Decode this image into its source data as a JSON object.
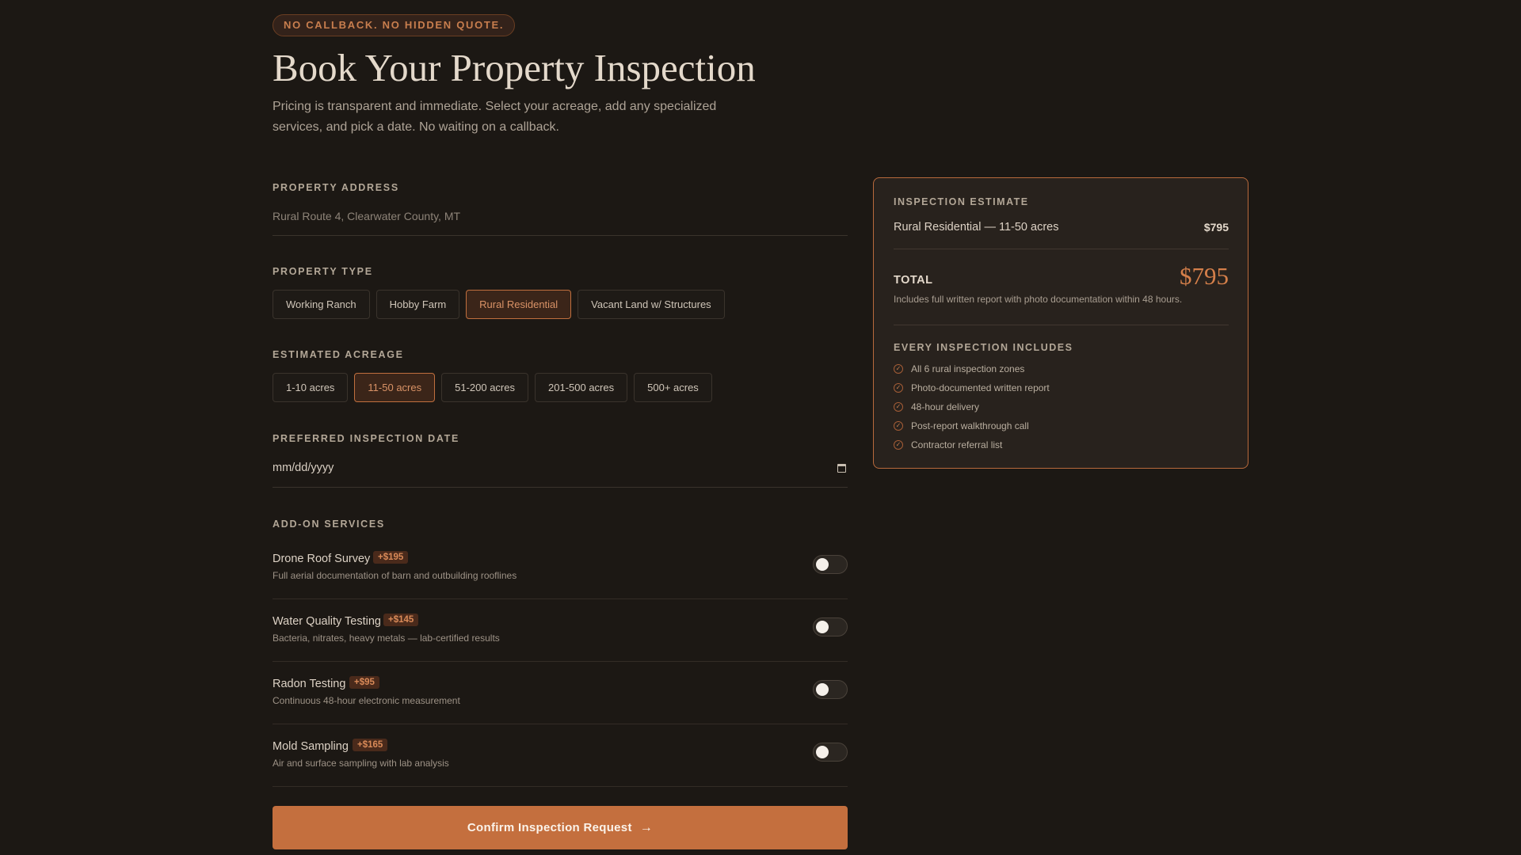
{
  "header": {
    "badge": "NO CALLBACK. NO HIDDEN QUOTE.",
    "title": "Book Your Property Inspection",
    "subtitle": "Pricing is transparent and immediate. Select your acreage, add any specialized services, and pick a date. No waiting on a callback."
  },
  "address": {
    "label": "PROPERTY ADDRESS",
    "placeholder": "Rural Route 4, Clearwater County, MT"
  },
  "property_type": {
    "label": "PROPERTY TYPE",
    "options": [
      "Working Ranch",
      "Hobby Farm",
      "Rural Residential",
      "Vacant Land w/ Structures"
    ],
    "selected": "Rural Residential"
  },
  "acreage": {
    "label": "ESTIMATED ACREAGE",
    "options": [
      "1-10 acres",
      "11-50 acres",
      "51-200 acres",
      "201-500 acres",
      "500+ acres"
    ],
    "selected": "11-50 acres"
  },
  "date": {
    "label": "PREFERRED INSPECTION DATE",
    "placeholder": "mm/dd/yyyy"
  },
  "addons": {
    "label": "ADD-ON SERVICES",
    "items": [
      {
        "name": "Drone Roof Survey",
        "price": "+$195",
        "desc": "Full aerial documentation of barn and outbuilding rooflines",
        "enabled": false
      },
      {
        "name": "Water Quality Testing",
        "price": "+$145",
        "desc": "Bacteria, nitrates, heavy metals — lab-certified results",
        "enabled": false
      },
      {
        "name": "Radon Testing",
        "price": "+$95",
        "desc": "Continuous 48-hour electronic measurement",
        "enabled": false
      },
      {
        "name": "Mold Sampling",
        "price": "+$165",
        "desc": "Air and surface sampling with lab analysis",
        "enabled": false
      }
    ]
  },
  "confirm": {
    "label": "Confirm Inspection Request",
    "icon": "arrow-right-icon"
  },
  "summary": {
    "label": "INSPECTION ESTIMATE",
    "line_item": "Rural Residential — 11-50 acres",
    "line_amount": "$795",
    "total_label": "TOTAL",
    "total_amount": "$795",
    "total_note": "Includes full written report with photo documentation within 48 hours.",
    "includes_label": "EVERY INSPECTION INCLUDES",
    "includes": [
      "All 6 rural inspection zones",
      "Photo-documented written report",
      "48-hour delivery",
      "Post-report walkthrough call",
      "Contractor referral list"
    ]
  },
  "colors": {
    "background": "#1c1814",
    "accent": "#c46f3e",
    "selected_chip_bg": "#3b2519"
  }
}
